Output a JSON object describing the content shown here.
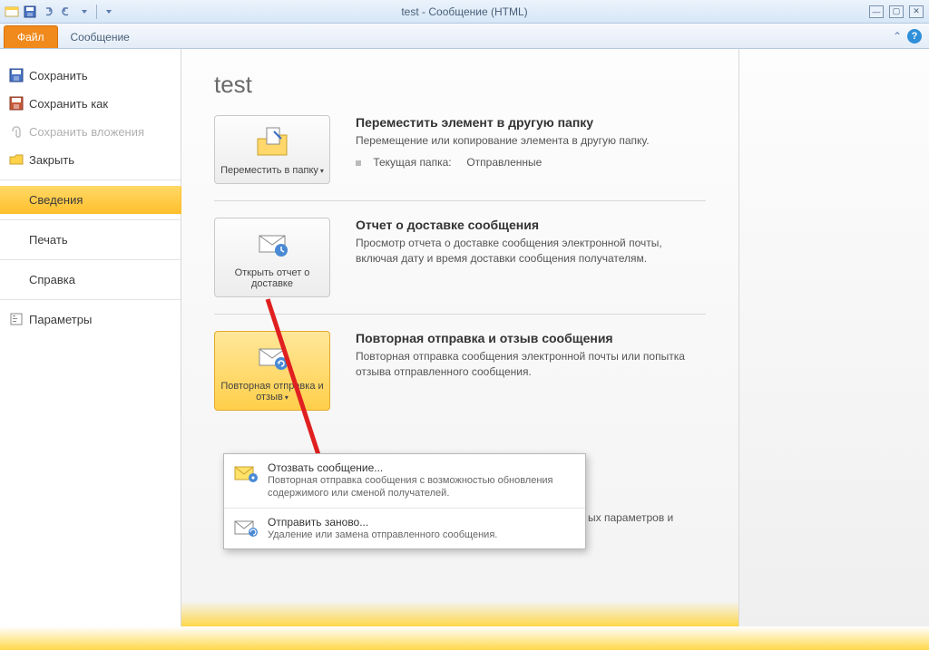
{
  "window": {
    "title": "test - Сообщение (HTML)"
  },
  "ribbon": {
    "file_tab": "Файл",
    "msg_tab": "Сообщение"
  },
  "sidebar": {
    "save": "Сохранить",
    "save_as": "Сохранить как",
    "save_attachments": "Сохранить вложения",
    "close": "Закрыть",
    "info": "Сведения",
    "print": "Печать",
    "help": "Справка",
    "options": "Параметры"
  },
  "main": {
    "title": "test",
    "section1": {
      "button": "Переместить в папку",
      "heading": "Переместить элемент в другую папку",
      "desc": "Перемещение или копирование элемента в другую папку.",
      "meta_label": "Текущая папка:",
      "meta_value": "Отправленные"
    },
    "section2": {
      "button": "Открыть отчет о доставке",
      "heading": "Отчет о доставке сообщения",
      "desc": "Просмотр отчета о доставке сообщения электронной почты, включая дату и время доставки сообщения получателям."
    },
    "section3": {
      "button": "Повторная отправка и отзыв",
      "heading": "Повторная отправка и отзыв сообщения",
      "desc": "Повторная отправка сообщения электронной почты или попытка отзыва отправленного сообщения."
    },
    "partial_text": "ых параметров и"
  },
  "menu": {
    "item1": {
      "title": "Отозвать сообщение...",
      "desc": "Повторная отправка сообщения с возможностью обновления содержимого или сменой получателей."
    },
    "item2": {
      "title": "Отправить заново...",
      "desc": "Удаление или замена отправленного сообщения."
    }
  }
}
